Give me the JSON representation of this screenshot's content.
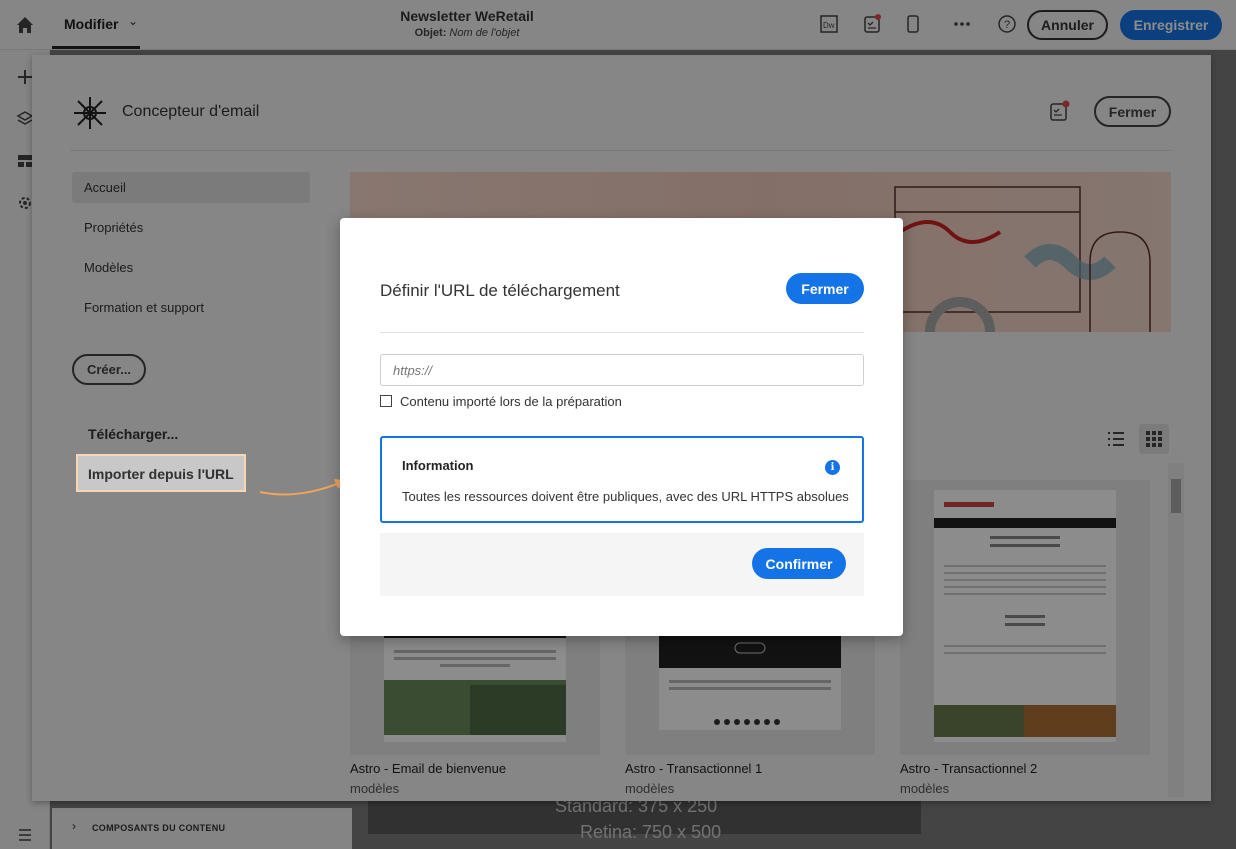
{
  "appbar": {
    "modifier_label": "Modifier",
    "title": "Newsletter WeRetail",
    "subject_label": "Objet:",
    "subject_value": "Nom de l'objet",
    "cancel_label": "Annuler",
    "save_label": "Enregistrer"
  },
  "designer": {
    "title": "Concepteur d'email",
    "close_label": "Fermer",
    "nav": [
      {
        "label": "Accueil",
        "active": true
      },
      {
        "label": "Propriétés",
        "active": false
      },
      {
        "label": "Modèles",
        "active": false
      },
      {
        "label": "Formation et support",
        "active": false
      }
    ],
    "create_label": "Créer...",
    "upload_label": "Télécharger...",
    "import_label": "Importer depuis l'URL",
    "cards": [
      {
        "title": "Astro - Email de bienvenue",
        "sub": "modèles"
      },
      {
        "title": "Astro - Transactionnel 1",
        "sub": "modèles"
      },
      {
        "title": "Astro - Transactionnel 2",
        "sub": "modèles"
      }
    ]
  },
  "bottom": {
    "section_label": "COMPOSANTS DU CONTENU",
    "img_text_1": "Standard: 375 x 250",
    "img_text_2": "Retina: 750 x 500"
  },
  "modal": {
    "title": "Définir l'URL de téléchargement",
    "close_label": "Fermer",
    "url_placeholder": "https://",
    "checkbox_label": "Contenu importé lors de la préparation",
    "info_title": "Information",
    "info_text": "Toutes les ressources doivent être publiques, avec des URL HTTPS absolues",
    "confirm_label": "Confirmer"
  },
  "colors": {
    "accent": "#1473e6",
    "highlight": "#f0a55b"
  }
}
